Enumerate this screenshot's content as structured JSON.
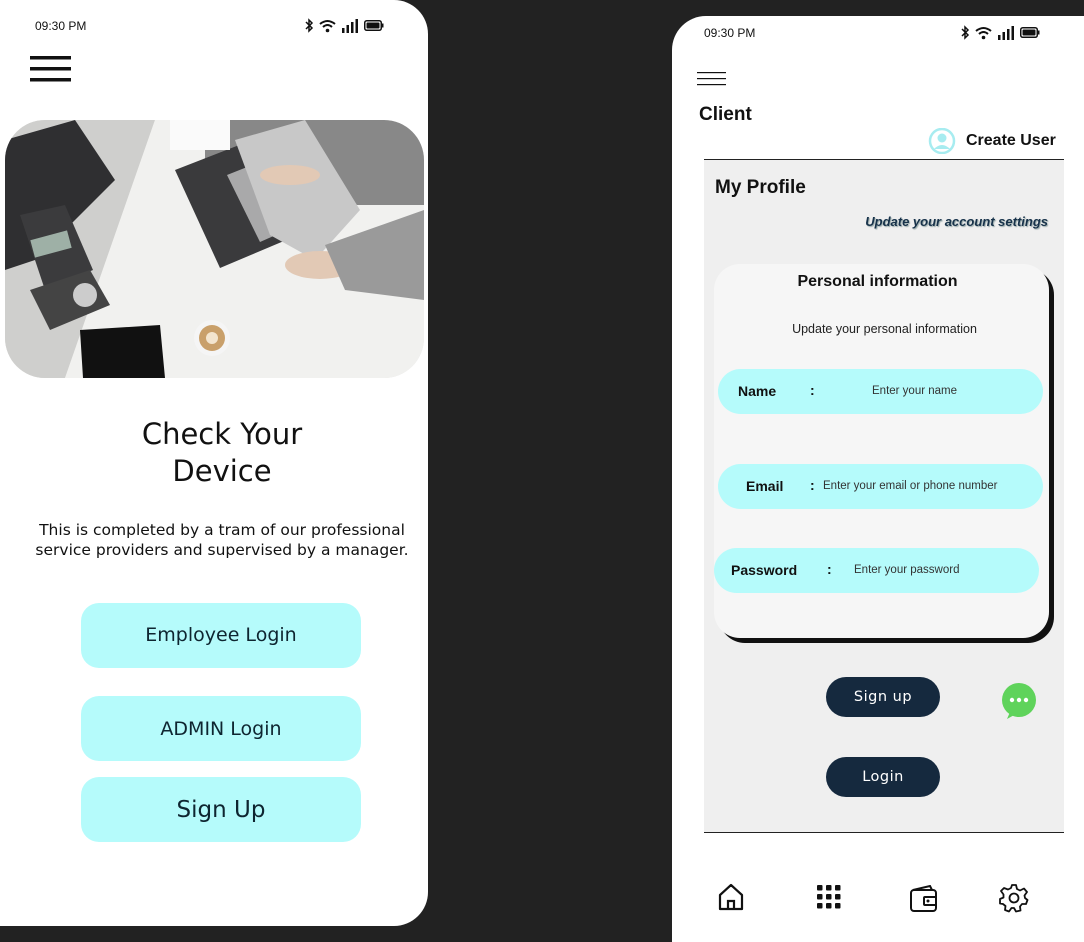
{
  "phone1": {
    "status_time": "09:30 PM",
    "title_line1": "Check Your",
    "title_line2": "Device",
    "description": "This is completed by a tram of our professional service providers and supervised by a manager.",
    "buttons": {
      "employee_login": "Employee Login",
      "admin_login": "ADMIN Login",
      "sign_up": "Sign Up"
    }
  },
  "phone2": {
    "status_time": "09:30 PM",
    "client_label": "Client",
    "create_user_label": "Create User",
    "my_profile": "My Profile",
    "update_settings": "Update your account settings",
    "card": {
      "title": "Personal information",
      "subtitle": "Update your personal information",
      "fields": {
        "name": {
          "label": "Name",
          "colon": ":",
          "placeholder": "Enter your name"
        },
        "email": {
          "label": "Email",
          "colon": ":",
          "placeholder": "Enter your email or phone number"
        },
        "password": {
          "label": "Password",
          "colon": ":",
          "placeholder": "Enter your password"
        }
      }
    },
    "signup_label": "Sign up",
    "login_label": "Login",
    "bottom_nav": [
      "home-icon",
      "grid-icon",
      "wallet-icon",
      "settings-icon"
    ]
  },
  "colors": {
    "background": "#222222",
    "button_cyan": "#b5fbfb",
    "dark_navy": "#15293e",
    "chat_green": "#5fd35b"
  }
}
